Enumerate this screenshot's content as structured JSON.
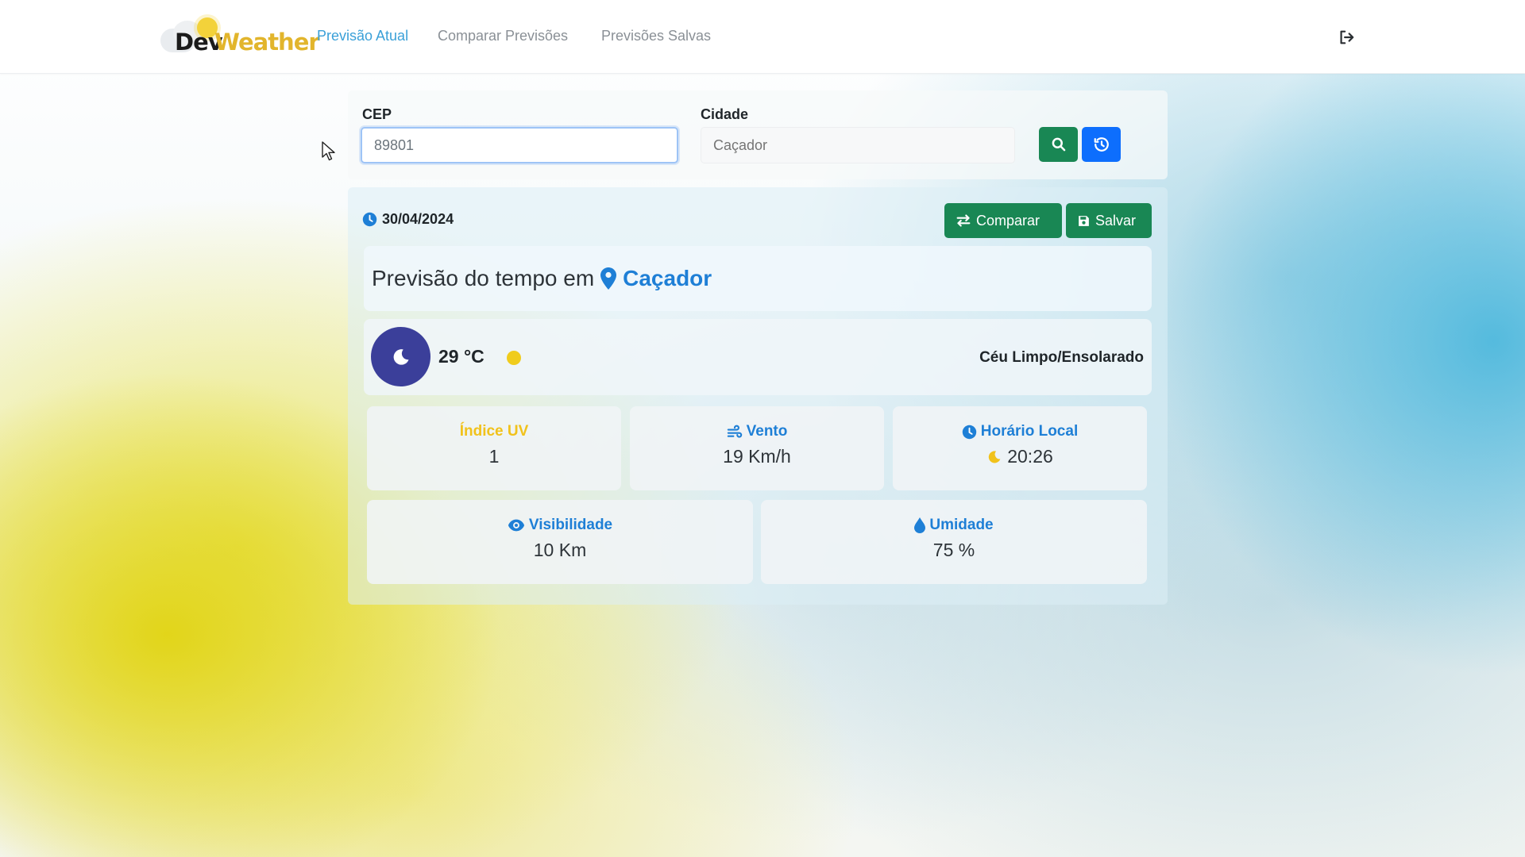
{
  "app": {
    "name_part1": "Dev",
    "name_part2": "Weather"
  },
  "nav": {
    "items": [
      {
        "label": "Previsão Atual",
        "active": true
      },
      {
        "label": "Comparar Previsões",
        "active": false
      },
      {
        "label": "Previsões Salvas",
        "active": false
      }
    ],
    "logout_icon": "sign-out-icon"
  },
  "search": {
    "cep_label": "CEP",
    "cep_value": "89801",
    "city_label": "Cidade",
    "city_placeholder": "Caçador",
    "search_icon": "search-icon",
    "history_icon": "history-icon"
  },
  "result": {
    "date": "30/04/2024",
    "compare_label": "Comparar",
    "save_label": "Salvar",
    "title_prefix": "Previsão do tempo em",
    "city": "Caçador",
    "temperature": "29 °C",
    "condition": "Céu Limpo/Ensolarado",
    "stats": {
      "uv": {
        "label": "Índice UV",
        "value": "1"
      },
      "wind": {
        "label": "Vento",
        "value": "19 Km/h"
      },
      "local_time": {
        "label": "Horário Local",
        "value": "20:26"
      },
      "visibility": {
        "label": "Visibilidade",
        "value": "10 Km"
      },
      "humidity": {
        "label": "Umidade",
        "value": "75 %"
      }
    }
  },
  "colors": {
    "link_active": "#3aa0d8",
    "accent_blue": "#1e7fd6",
    "button_green": "#198754",
    "button_blue": "#0d6efd",
    "uv_yellow": "#f1c21b",
    "moon_bg": "#3b3f9a"
  }
}
